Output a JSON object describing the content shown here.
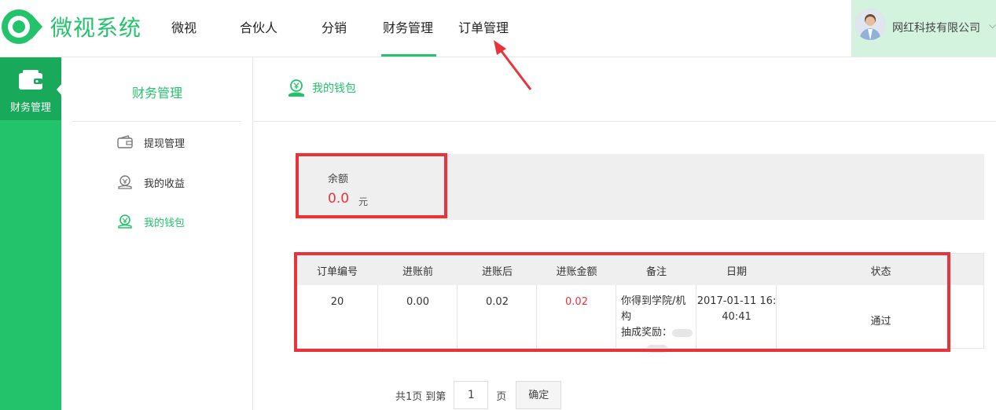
{
  "brand": {
    "name": "微视系统",
    "color": "#22c36a",
    "icon": "eye-logo-icon"
  },
  "nav": {
    "items": [
      {
        "label": "微视"
      },
      {
        "label": "合伙人"
      },
      {
        "label": "分销"
      },
      {
        "label": "财务管理",
        "active": true
      },
      {
        "label": "订单管理"
      }
    ]
  },
  "user": {
    "company": "网红科技有限公司",
    "caret": "⌵"
  },
  "leftbar": {
    "label": "财务管理",
    "icon": "wallet-icon"
  },
  "subnav": {
    "title": "财务管理",
    "items": [
      {
        "label": "提现管理",
        "icon": "withdraw-icon"
      },
      {
        "label": "我的收益",
        "icon": "earnings-icon"
      },
      {
        "label": "我的钱包",
        "icon": "wallet-user-icon",
        "active": true
      }
    ]
  },
  "wallet_tab": {
    "label": "我的钱包",
    "icon": "yuan-hand-icon"
  },
  "balance": {
    "label": "余额",
    "value": "0.0",
    "unit": "元"
  },
  "table": {
    "headers": [
      "订单编号",
      "进账前",
      "进账后",
      "进账金额",
      "备注",
      "日期",
      "状态"
    ],
    "rows": [
      {
        "order_no": "20",
        "before": "0.00",
        "after": "0.02",
        "amount": "0.02",
        "note_line1": "你得到学院/机构",
        "note_line2": "抽成奖励：",
        "date_line1": "2017-01-11 16:",
        "date_line2": "40:41",
        "status": "通过"
      }
    ]
  },
  "pager": {
    "total": "共1页",
    "goto": "到第",
    "page": "1",
    "page_unit": "页",
    "confirm": "确定"
  },
  "colors": {
    "accent": "#22c36a",
    "highlight": "#e8333b"
  }
}
